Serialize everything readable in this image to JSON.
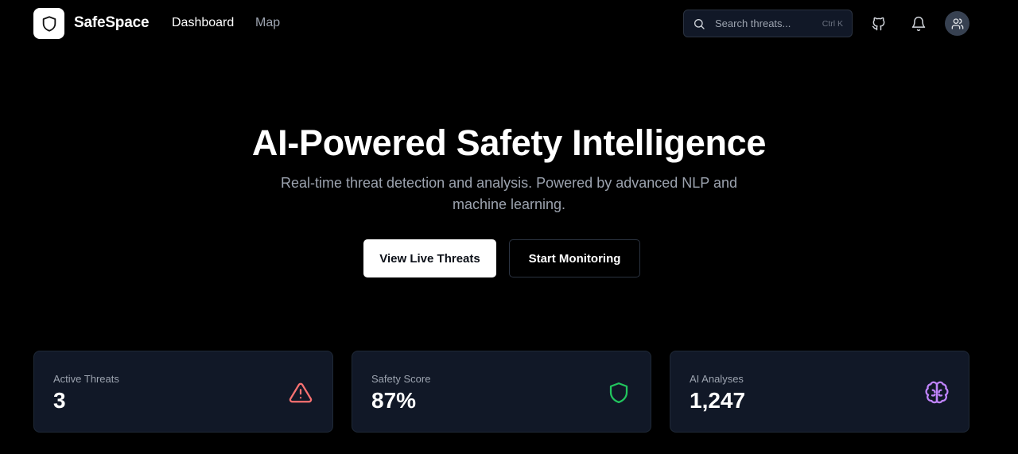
{
  "brand": {
    "name": "SafeSpace",
    "logo_icon": "shield-icon"
  },
  "nav": {
    "links": [
      {
        "label": "Dashboard",
        "active": true
      },
      {
        "label": "Map",
        "active": false
      }
    ]
  },
  "search": {
    "placeholder": "Search threats...",
    "shortcut": "Ctrl K"
  },
  "header_icons": [
    "github-icon",
    "bell-icon",
    "users-icon"
  ],
  "hero": {
    "title": "AI-Powered Safety Intelligence",
    "subtitle": "Real-time threat detection and analysis. Powered by advanced NLP and machine learning.",
    "primary_button": "View Live Threats",
    "secondary_button": "Start Monitoring"
  },
  "stats": [
    {
      "label": "Active Threats",
      "value": "3",
      "icon": "alert-triangle-icon",
      "color": "#f87171"
    },
    {
      "label": "Safety Score",
      "value": "87%",
      "icon": "shield-icon",
      "color": "#22c55e"
    },
    {
      "label": "AI Analyses",
      "value": "1,247",
      "icon": "brain-icon",
      "color": "#c084fc"
    }
  ],
  "colors": {
    "background": "#000000",
    "card": "#111827",
    "muted_text": "#9ca3af"
  }
}
